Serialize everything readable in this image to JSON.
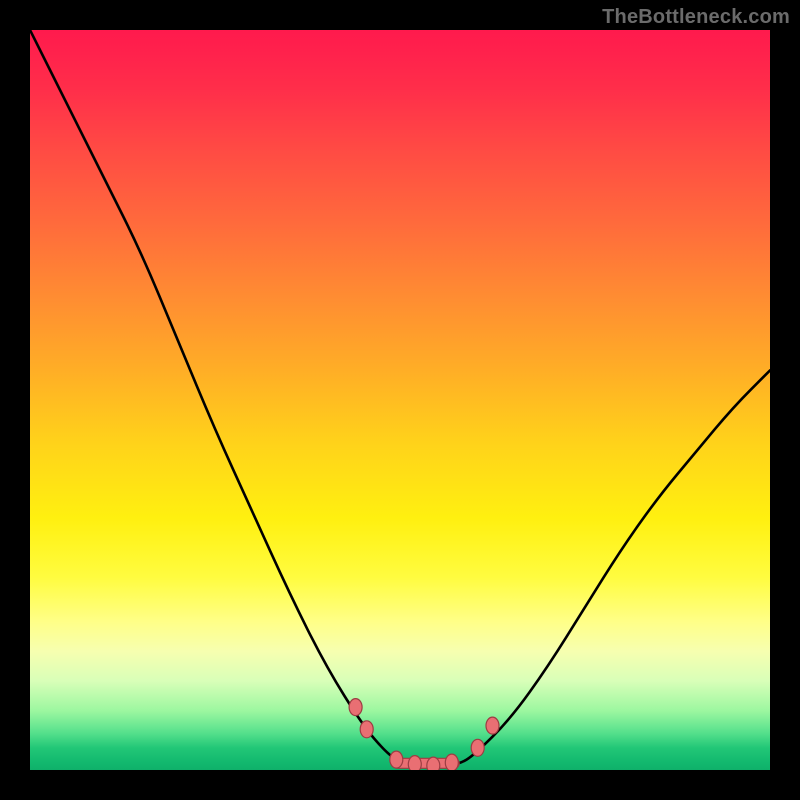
{
  "attribution": "TheBottleneck.com",
  "colors": {
    "frame": "#000000",
    "curve": "#000000",
    "marker_fill": "#e96f73",
    "marker_stroke": "#9c3d43",
    "gradient_top": "#ff1a4d",
    "gradient_bottom": "#0fb06a"
  },
  "chart_data": {
    "type": "line",
    "title": "",
    "xlabel": "",
    "ylabel": "",
    "xlim": [
      0,
      1
    ],
    "ylim": [
      0,
      1
    ],
    "grid": false,
    "series": [
      {
        "name": "bottleneck-curve",
        "x": [
          0.0,
          0.05,
          0.1,
          0.15,
          0.2,
          0.25,
          0.3,
          0.35,
          0.4,
          0.45,
          0.48,
          0.5,
          0.52,
          0.55,
          0.58,
          0.6,
          0.65,
          0.7,
          0.75,
          0.8,
          0.85,
          0.9,
          0.95,
          1.0
        ],
        "y": [
          1.0,
          0.9,
          0.8,
          0.7,
          0.58,
          0.46,
          0.35,
          0.24,
          0.14,
          0.06,
          0.025,
          0.01,
          0.005,
          0.003,
          0.008,
          0.02,
          0.07,
          0.14,
          0.22,
          0.3,
          0.37,
          0.43,
          0.49,
          0.54
        ]
      }
    ],
    "markers": [
      {
        "name": "left-upper-dot",
        "x": 0.44,
        "y": 0.085
      },
      {
        "name": "left-lower-dot",
        "x": 0.455,
        "y": 0.055
      },
      {
        "name": "min-dot-1",
        "x": 0.495,
        "y": 0.014
      },
      {
        "name": "min-dot-2",
        "x": 0.52,
        "y": 0.008
      },
      {
        "name": "min-dot-3",
        "x": 0.545,
        "y": 0.006
      },
      {
        "name": "min-dot-4",
        "x": 0.57,
        "y": 0.01
      },
      {
        "name": "right-lower-dot",
        "x": 0.605,
        "y": 0.03
      },
      {
        "name": "right-upper-dot",
        "x": 0.625,
        "y": 0.06
      }
    ],
    "annotations": [
      {
        "name": "flat-bottom-lozenge",
        "x0": 0.49,
        "x1": 0.58,
        "y": 0.009
      }
    ]
  }
}
